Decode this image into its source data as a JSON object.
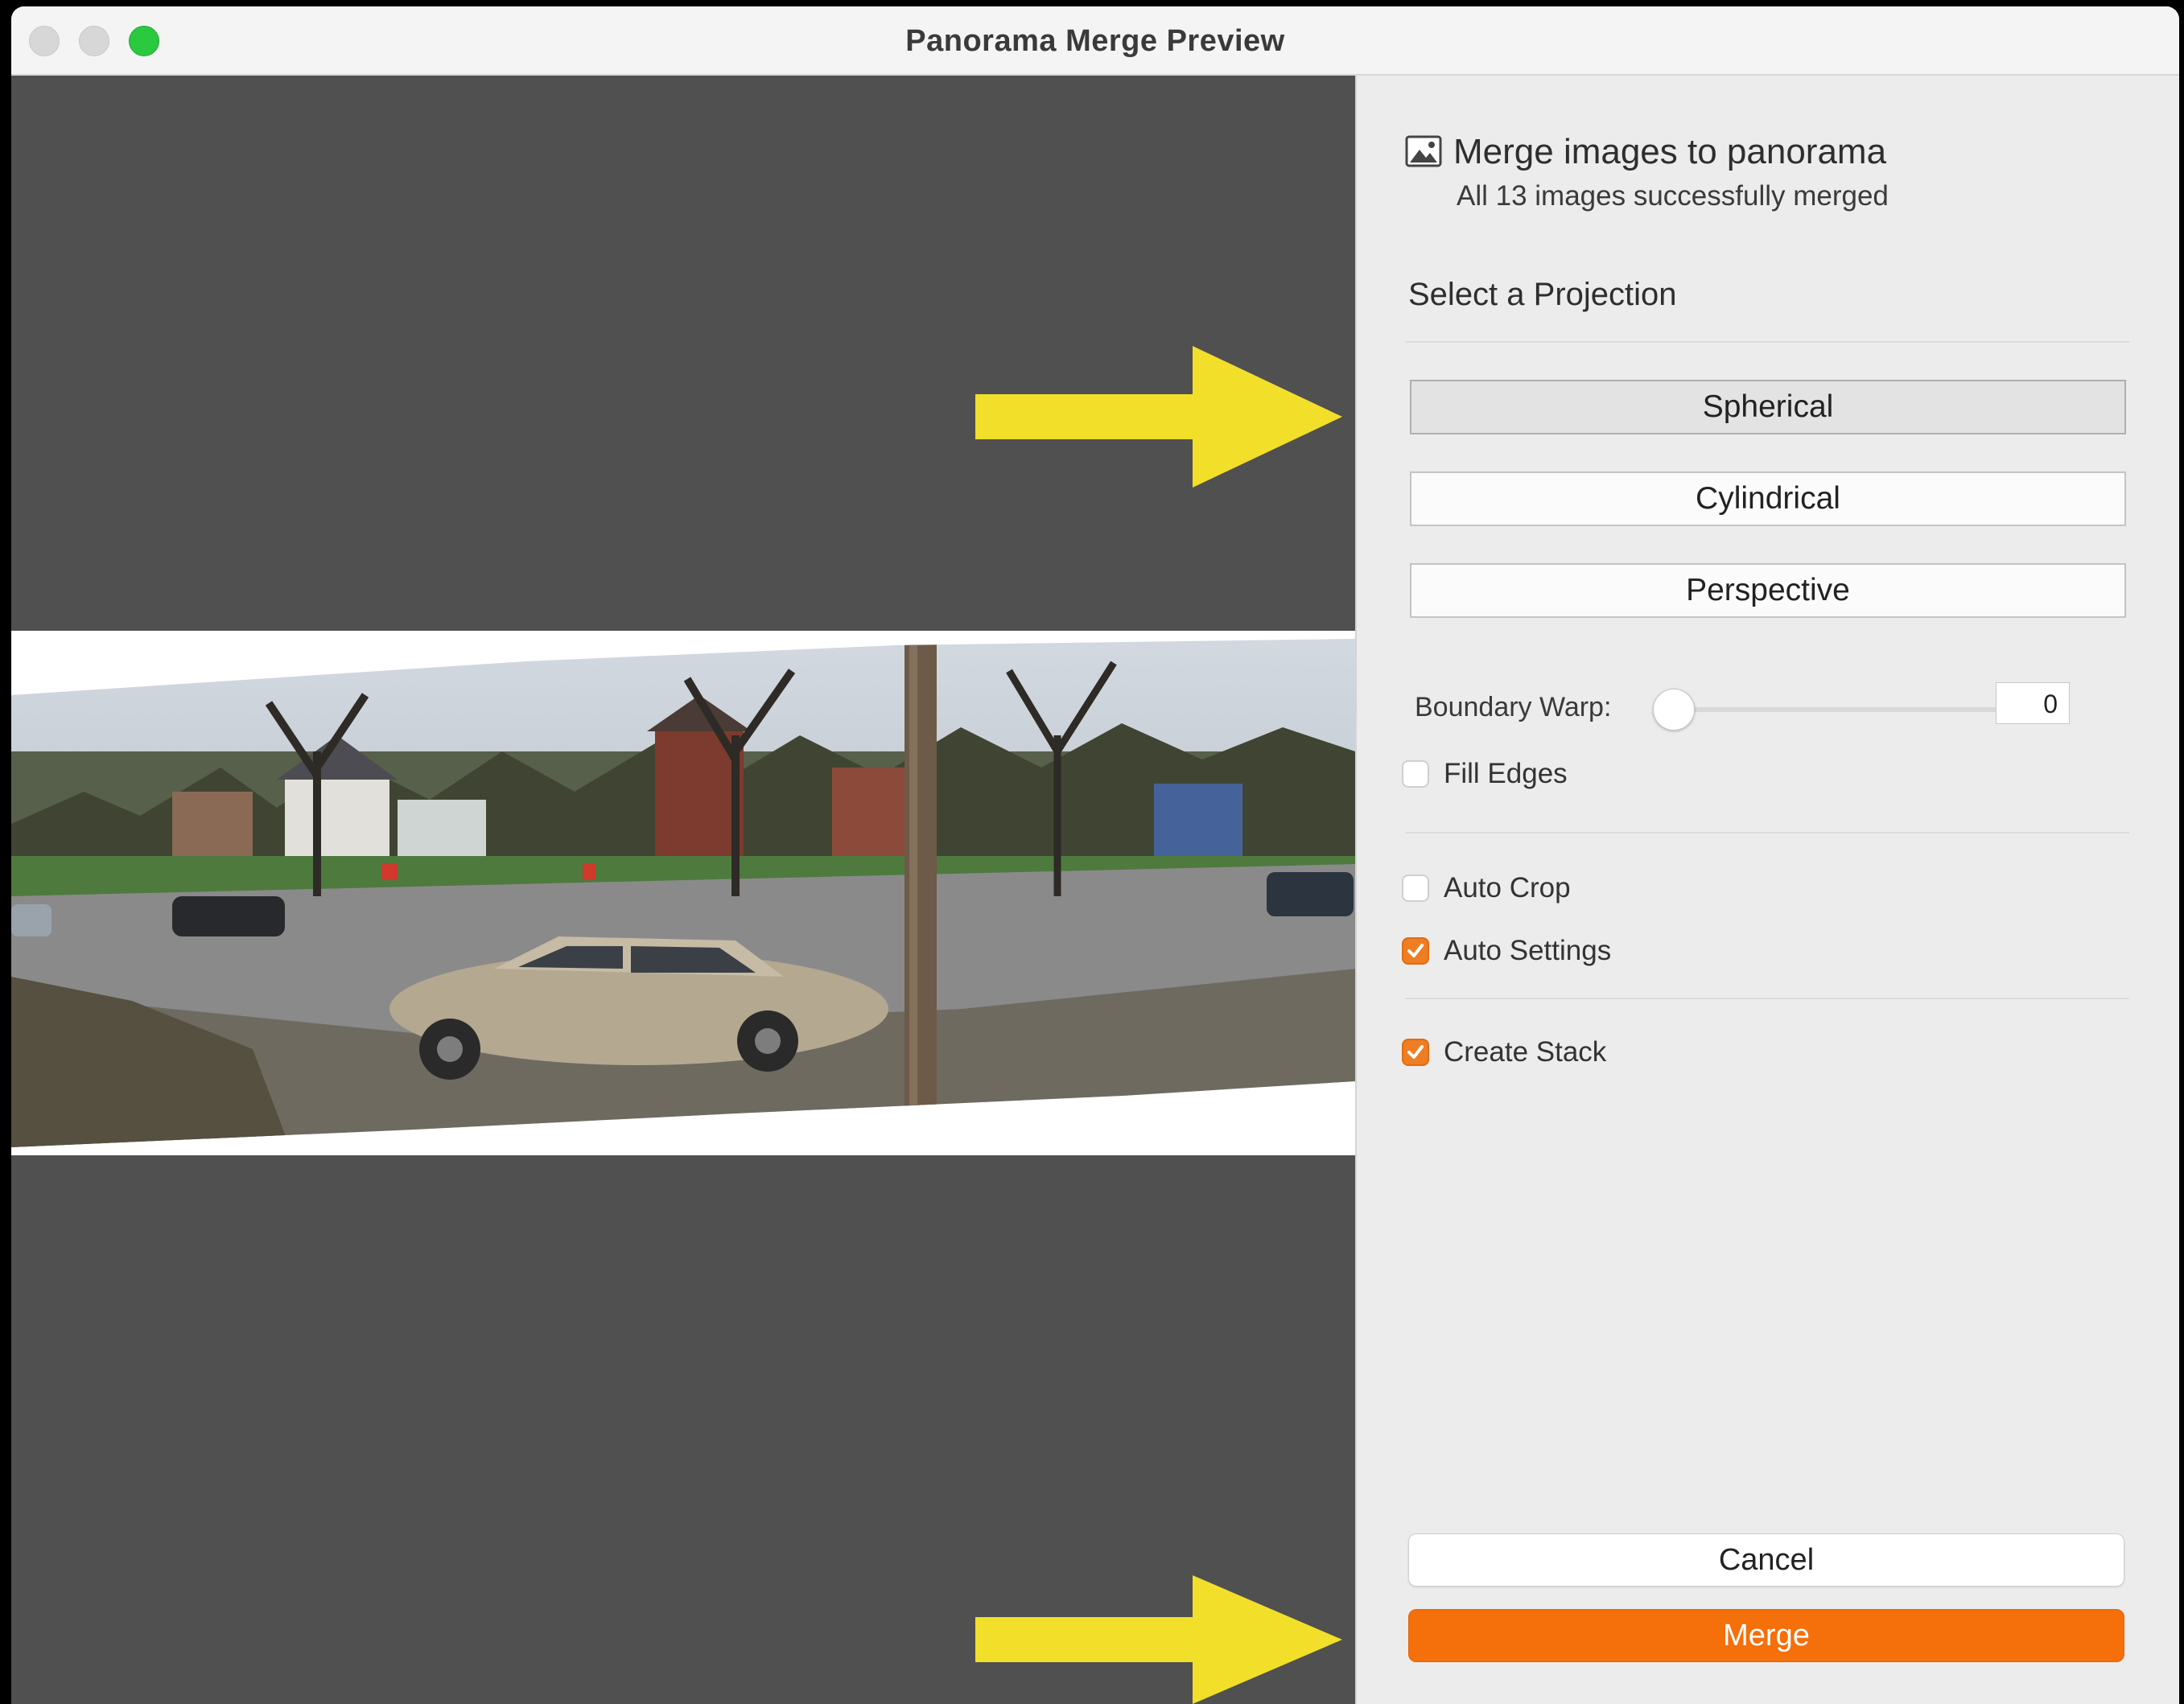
{
  "window": {
    "title": "Panorama Merge Preview"
  },
  "panel": {
    "header_title": "Merge images to panorama",
    "header_status": "All 13 images successfully merged",
    "projection_label": "Select a Projection",
    "projections": [
      "Spherical",
      "Cylindrical",
      "Perspective"
    ],
    "selected_projection": "Spherical",
    "boundary_warp_label": "Boundary Warp:",
    "boundary_warp_value": "0",
    "options": {
      "fill_edges": {
        "label": "Fill Edges",
        "checked": false
      },
      "auto_crop": {
        "label": "Auto Crop",
        "checked": false
      },
      "auto_settings": {
        "label": "Auto Settings",
        "checked": true
      },
      "create_stack": {
        "label": "Create Stack",
        "checked": true
      }
    },
    "cancel_label": "Cancel",
    "merge_label": "Merge"
  },
  "icons": {
    "panorama": "panorama-image-icon",
    "check": "checkmark-icon",
    "arrow": "annotation-arrow-icon"
  },
  "colors": {
    "accent": "#f56f0a",
    "checkbox": "#ef7d22",
    "arrow": "#f2df2a",
    "preview_bg": "#505050",
    "traffic_green": "#2bc940"
  }
}
